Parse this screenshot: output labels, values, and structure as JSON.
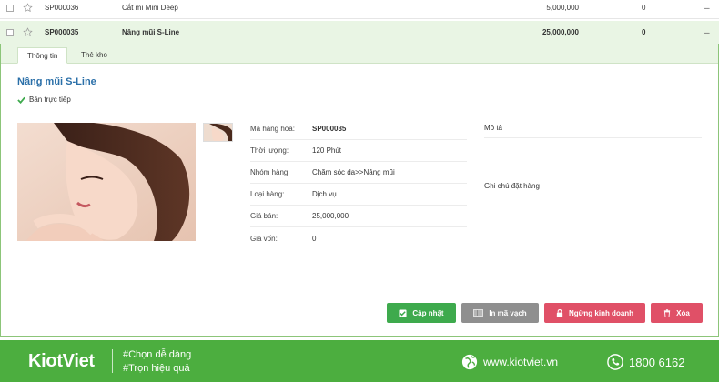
{
  "rows": [
    {
      "code": "SP000036",
      "name": "Cắt mí Mini Deep",
      "price": "5,000,000",
      "qty": "0",
      "more": "---"
    },
    {
      "code": "SP000035",
      "name": "Nâng mũi S-Line",
      "price": "25,000,000",
      "qty": "0",
      "more": "---"
    }
  ],
  "tabs": {
    "info": "Thông tin",
    "stock": "Thẻ kho"
  },
  "product": {
    "title": "Nâng mũi S-Line",
    "direct_sale": "Bán trực tiếp",
    "fields": [
      {
        "label": "Mã hàng hóa:",
        "value": "SP000035"
      },
      {
        "label": "Thời lượng:",
        "value": "120 Phút"
      },
      {
        "label": "Nhóm hàng:",
        "value": "Chăm sóc da>>Nâng mũi"
      },
      {
        "label": "Loại hàng:",
        "value": "Dịch vụ"
      },
      {
        "label": "Giá bán:",
        "value": "25,000,000"
      },
      {
        "label": "Giá vốn:",
        "value": "0"
      }
    ],
    "description_label": "Mô tả",
    "order_note_label": "Ghi chú đặt hàng"
  },
  "buttons": {
    "update": "Cập nhật",
    "barcode": "In mã vạch",
    "stop": "Ngừng kinh doanh",
    "delete": "Xóa"
  },
  "footer": {
    "logo": "KiotViet",
    "slogan1": "#Chọn dễ dàng",
    "slogan2": "#Trọn hiệu quả",
    "website": "www.kiotviet.vn",
    "phone": "1800 6162"
  },
  "colors": {
    "accent_green": "#3eaa4d",
    "link_blue": "#2a6fa8",
    "danger": "#e05067",
    "footer_green": "#4cae3f"
  }
}
